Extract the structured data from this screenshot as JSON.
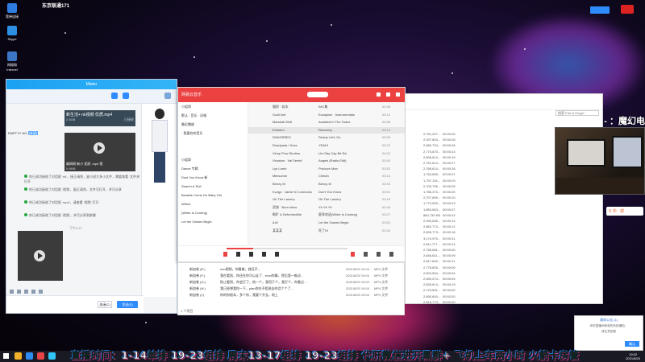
{
  "desktop": {
    "top_title": "东京联通171",
    "icons": [
      {
        "label": "宽带连接",
        "color": "#2d7de0"
      },
      {
        "label": "Skype",
        "color": "#2c8fe2"
      },
      {
        "label": "网络和Internet",
        "color": "#3b75c4"
      }
    ],
    "corner_badge": "",
    "overlay_text": "- ：魔幻电"
  },
  "chat": {
    "title": "Mister",
    "file_card": {
      "name": "新生活+ nk视频 优质.mp4",
      "size": "2.5GB",
      "status": "已接收"
    },
    "video_card": {
      "name": "威网网 新小 优质 .mp4 视",
      "size": "5.6MB"
    },
    "sender": "EMPTYY NO",
    "sender_tag": "[未读]",
    "system_messages": [
      "你已成功接收了对话框 ‘nk’，接正请到，副小说大多小文件，需要查看 ‘文件夹’ 打开",
      "你已成功接收了对话框 ‘视频’，副正请到，文件可打开，并可分享",
      "你已成功接收了对话框 ‘mp4’，请查看 ‘视频’ 打开",
      "你已成功接收了对话框 ‘视频’，并可分享到群聊"
    ],
    "time_label": "下午2:47",
    "send_label": "发送(S)",
    "close_label": "关闭(C)"
  },
  "music": {
    "logo": "网易云音乐",
    "left_rows": [
      "小姐哥",
      "默认 · 音乐 · 风格",
      "最近播放",
      "· 我喜欢的音乐",
      "",
      "",
      "小姐哥",
      "Dance 专辑",
      "Dont You Know 新",
      "Search & Roll",
      "Breathe Come On Baby Girl",
      "Wheel",
      "(White Is Coming)",
      "Let the Games Begin"
    ],
    "tracks": [
      {
        "title": "猫抓 · 若本",
        "artist": "IMC集",
        "duration": "03:38"
      },
      {
        "title": "SoulChef",
        "artist": "Escapism · Instrumentals",
        "duration": "03:12"
      },
      {
        "title": "Marshall Wolf",
        "artist": "Assisted In The Grave",
        "duration": "02:58"
      },
      {
        "title": "Eminem",
        "artist": "Recovery",
        "duration": "04:10",
        "selected": true
      },
      {
        "title": "DANGRBEG",
        "artist": "Ready Let's Go",
        "duration": "03:05"
      },
      {
        "title": "Roadyaria / Kess",
        "artist": "YEAH!",
        "duration": "03:22"
      },
      {
        "title": "Vinny Flow Studios",
        "artist": "Ua Ciày Cây Bè Đá",
        "duration": "04:02"
      },
      {
        "title": "Vicariow · Val Sentel",
        "artist": "Angels (Radio Edit)",
        "duration": "03:40"
      },
      {
        "title": "Lyn Lamb",
        "artist": "Produce Man",
        "duration": "02:51"
      },
      {
        "title": "Milesomm",
        "artist": "Chinah",
        "duration": "03:14"
      },
      {
        "title": "Benny M",
        "artist": "Benny M",
        "duration": "03:33"
      },
      {
        "title": "Kungs · Jamie N Commons",
        "artist": "Don't You Know",
        "duration": "03:01"
      },
      {
        "title": "Oh The Larcery",
        "artist": "Oh The Larcery",
        "duration": "03:19"
      },
      {
        "title": "武侠 · Bom shew",
        "artist": "Yè Yè Yè",
        "duration": "02:46"
      },
      {
        "title": "断旷 & DeformedMe",
        "artist": "夏季欢迎(White Is Coming)",
        "duration": "03:27"
      },
      {
        "title": "iLW",
        "artist": "Let the Games Begin",
        "duration": "03:52"
      },
      {
        "title": "某某某",
        "artist": "死了Hi",
        "duration": "02:40"
      }
    ]
  },
  "explorer": {
    "search_placeholder": "搜索\"Fall of Kinga\"",
    "rows": [
      {
        "size": "2,751,227...",
        "time": "00:00:00"
      },
      {
        "size": "2,937,804...",
        "time": "00:00:28"
      },
      {
        "size": "2,680,734...",
        "time": "00:00:26"
      },
      {
        "size": "2,774,670...",
        "time": "00:00:23"
      },
      {
        "size": "2,806,614...",
        "time": "00:00:19"
      },
      {
        "size": "2,751,614...",
        "time": "00:00:27"
      },
      {
        "size": "2,766,614...",
        "time": "00:00:28"
      },
      {
        "size": "1,764,665...",
        "time": "00:00:21"
      },
      {
        "size": "1,797,115...",
        "time": "00:00:29"
      },
      {
        "size": "2,700,796...",
        "time": "00:00:25"
      },
      {
        "size": "1,786,373...",
        "time": "00:00:00"
      },
      {
        "size": "2,707,895...",
        "time": "00:00:10"
      },
      {
        "size": "1,772,530...",
        "time": "00:00:23"
      },
      {
        "size": "1,850,563...",
        "time": "00:00:07"
      },
      {
        "size": "860,733 KB",
        "time": "00:00:24"
      },
      {
        "size": "2,990,636...",
        "time": "00:00:14"
      },
      {
        "size": "2,862,774...",
        "time": "00:00:12"
      },
      {
        "size": "2,699,773...",
        "time": "00:00:18"
      },
      {
        "size": "3,174,975...",
        "time": "00:00:31"
      },
      {
        "size": "2,811,777...",
        "time": "00:00:14"
      },
      {
        "size": "2,755,681...",
        "time": "00:00:00"
      },
      {
        "size": "2,846,611...",
        "time": "00:00:09"
      },
      {
        "size": "2,817,600...",
        "time": "00:00:11"
      },
      {
        "size": "2,778,835...",
        "time": "00:00:00"
      },
      {
        "size": "2,800,554...",
        "time": "00:00:04"
      },
      {
        "size": "2,830,074...",
        "time": "00:00:09"
      },
      {
        "size": "2,826,614...",
        "time": "00:00:19"
      },
      {
        "size": "2,724,801...",
        "time": "00:00:00"
      },
      {
        "size": "2,650,600...",
        "time": "00:00:20"
      },
      {
        "size": "2,816,773...",
        "time": "00:00:00"
      }
    ]
  },
  "filelist": {
    "rows": [
      {
        "drive": "新加卷 (E:)",
        "name": "nnn视频，你看着，就还不…",
        "date": "2021/8/20 19:04",
        "type": "MP4 文件",
        "size": ""
      },
      {
        "drive": "新加卷 (F:)",
        "name": "我在看到，你还在你可以走了…nmd你算，然后我一唯动…",
        "date": "2021/8/20 19:04",
        "type": "MP4 文件",
        "size": ""
      },
      {
        "drive": "新加卷 (G:)",
        "name": "防止看到，你会打了，他一个，我用于个，我打个，你看过…",
        "date": "2021/8/20 19:04",
        "type": "MP4 文件",
        "size": ""
      },
      {
        "drive": "新加卷 (H:)",
        "name": "我已经想我你一下，plan你在不相进去的话个个了…",
        "date": "2021/8/20 19:04",
        "type": "MP4 文件",
        "size": ""
      },
      {
        "drive": "新加卷 (I:)",
        "name": "你的你根本，多个你，我要个开去，地上",
        "date": "2021/8/20 19:04",
        "type": "MP4 文件",
        "size": ""
      }
    ],
    "footer": "1 个项目"
  },
  "ime": {
    "label": "S 中 · 拼"
  },
  "notice": {
    "title": "通知公告 (1)",
    "line1": "你的直播间有新的系统通知，",
    "line2": "请注意查看",
    "btn": "确认"
  },
  "caption": "直播时间：1-14单排 19-23组排 周末13-17组排 19-23组排 代肝微信进开黑群+ 飞机上车两小时 火箭卡房管",
  "clock": {
    "time": "19:02",
    "date": "2021/8/20"
  }
}
